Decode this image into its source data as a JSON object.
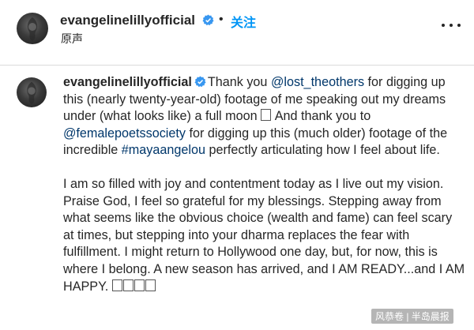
{
  "header": {
    "username": "evangelinelillyofficial",
    "separator": "•",
    "follow_label": "关注",
    "subtitle": "原声"
  },
  "caption": {
    "username": "evangelinelillyofficial",
    "text1": "Thank you ",
    "mention1": "@lost_theothers",
    "text2": " for digging up this (nearly twenty-year-old) footage of me speaking out my dreams under (what looks like) a full moon ",
    "text3": " And thank you to ",
    "mention2": "@femalepoetssociety",
    "text4": " for digging up this (much older) footage of the incredible ",
    "hashtag": "#mayaangelou",
    "text5": " perfectly articulating how I feel about life.",
    "paragraph2": "I am so filled with joy and contentment today as I live out my vision. Praise God, I feel so grateful for my blessings. Stepping away from what seems like the obvious choice (wealth and fame) can feel scary at times, but stepping into your dharma replaces the fear with fulfillment. I might return to Hollywood one day, but, for now, this is where I belong. A new season has arrived, and I AM READY...and I AM HAPPY. "
  },
  "watermark": "风恭卷 | 半岛晨报",
  "colors": {
    "accent": "#0095f6",
    "link": "#00376b",
    "verified": "#3897f0"
  },
  "icons": [
    "verified-badge-icon",
    "more-options-icon"
  ]
}
